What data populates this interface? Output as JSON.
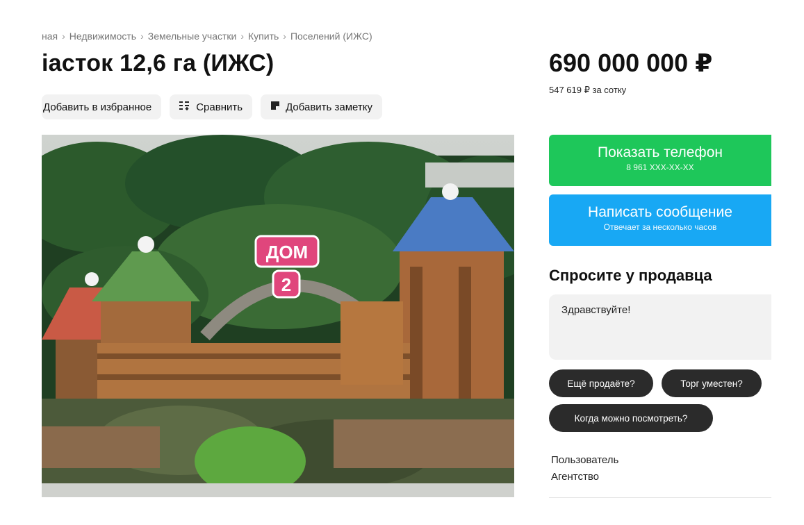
{
  "breadcrumb": [
    "ная",
    "Недвижимость",
    "Земельные участки",
    "Купить",
    "Поселений (ИЖС)"
  ],
  "breadcrumb_separator": "›",
  "listing": {
    "title": "iасток 12,6 га (ИЖС)",
    "price": "690 000 000 ₽",
    "price_per_unit": "547 619 ₽ за сотку"
  },
  "actions": {
    "favorite_label": "Добавить в избранное",
    "compare_label": "Сравнить",
    "note_label": "Добавить заметку"
  },
  "photo": {
    "sign_text": "ДОМ",
    "sign_number": "2"
  },
  "contact": {
    "phone_label": "Показать телефон",
    "phone_masked": "8 961 XXX-XX-XX",
    "message_label": "Написать сообщение",
    "message_sub": "Отвечает за несколько часов"
  },
  "ask": {
    "title": "Спросите у продавца",
    "message_value": "Здравствуйте!",
    "chips": [
      "Ещё продаёте?",
      "Торг уместен?",
      "Когда можно посмотреть?"
    ]
  },
  "seller": {
    "role": "Пользователь",
    "type": "Агентство"
  },
  "colors": {
    "green": "#1ec75a",
    "blue": "#18a8f4",
    "chip_bg": "#2b2b2b"
  }
}
